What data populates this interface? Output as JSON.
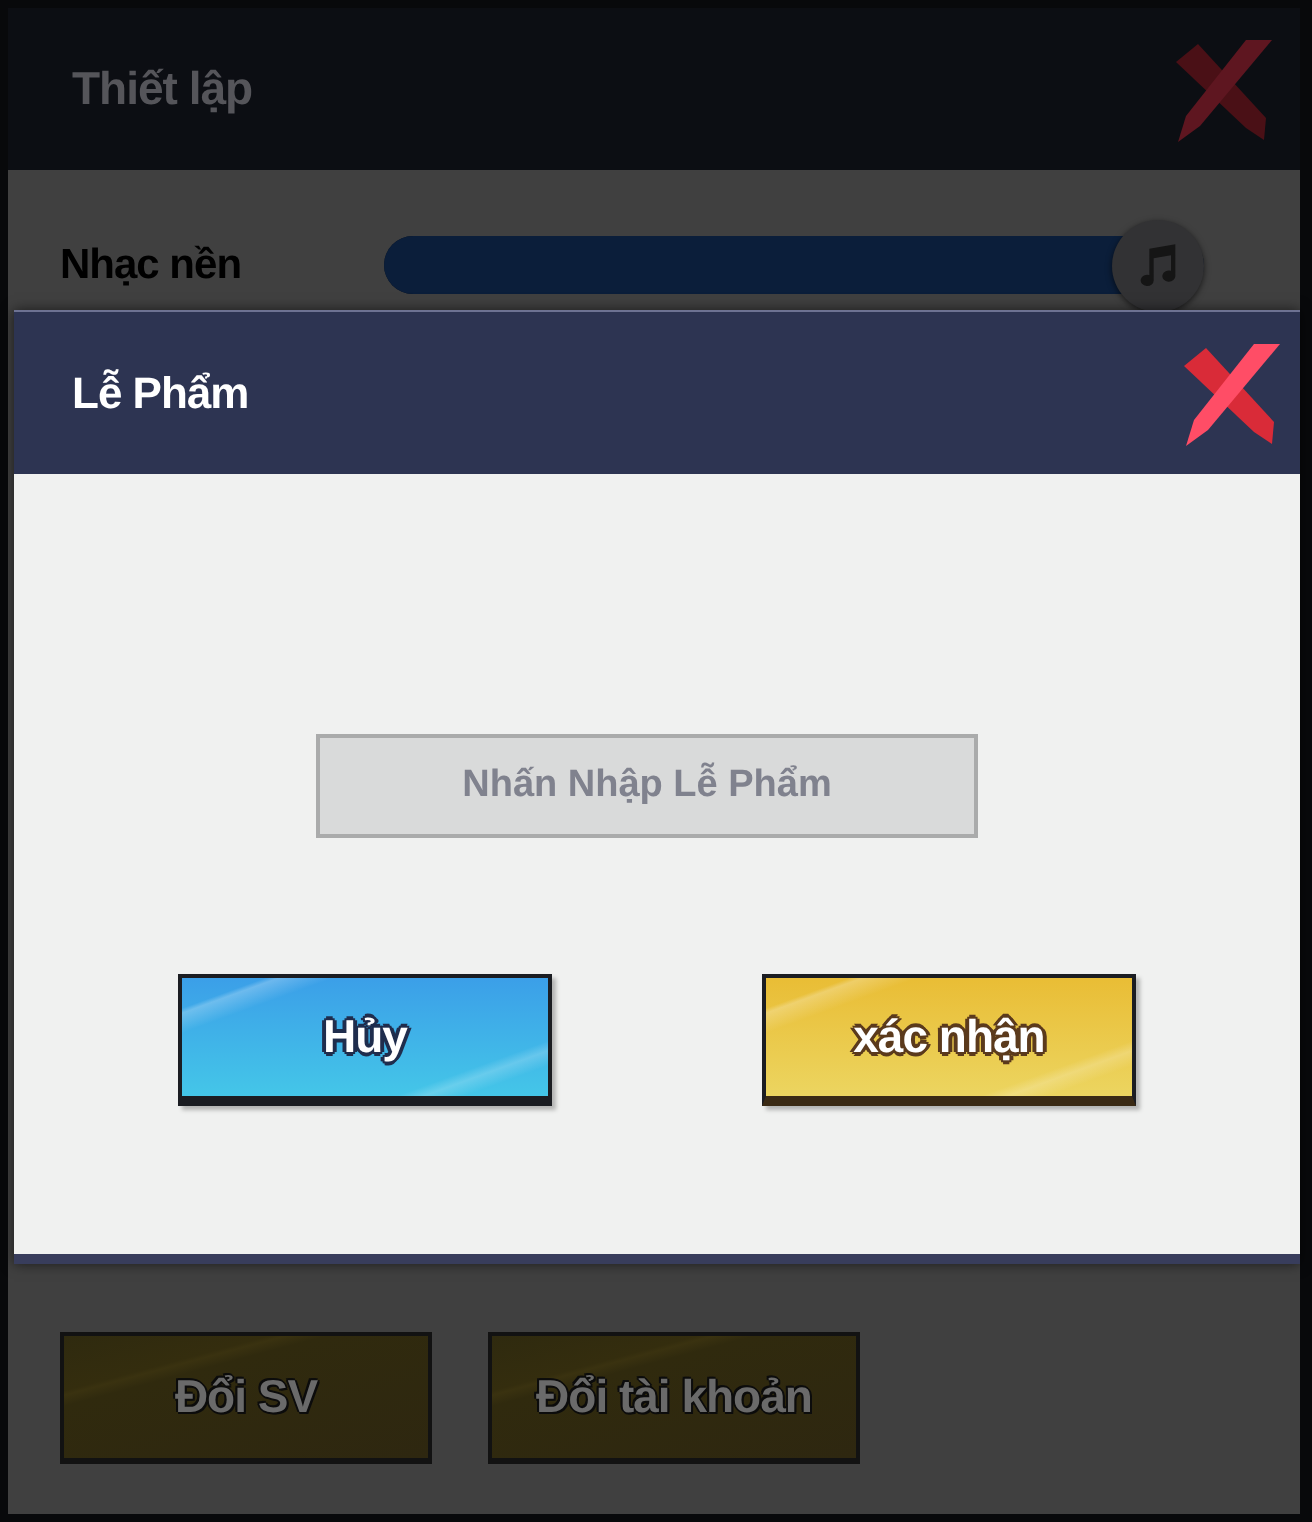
{
  "settings": {
    "title": "Thiết lập",
    "music": {
      "label": "Nhạc nền",
      "level": 1
    },
    "buttons": [
      {
        "label": "Đổi SV"
      },
      {
        "label": "Đổi tài khoản"
      }
    ]
  },
  "dialog": {
    "title": "Lễ Phẩm",
    "input": {
      "placeholder": "Nhấn Nhập Lễ Phẩm"
    },
    "buttons": [
      {
        "label": "Hủy",
        "kind": "cancel"
      },
      {
        "label": "xác nhận",
        "kind": "confirm"
      }
    ]
  }
}
